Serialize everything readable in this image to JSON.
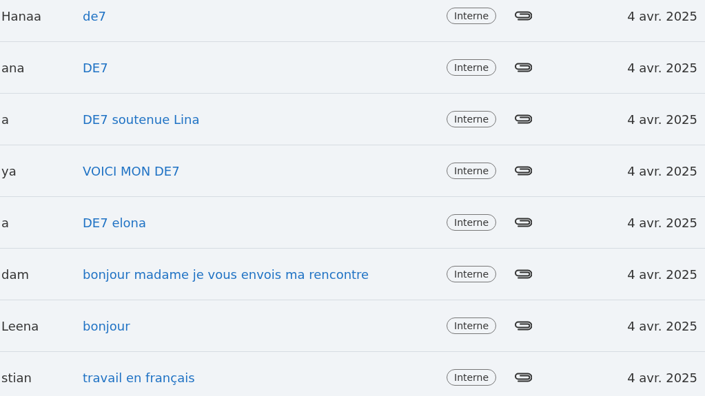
{
  "messages": [
    {
      "sender": "Hanaa",
      "subject": "de7",
      "tag": "Interne",
      "date": "4 avr. 2025"
    },
    {
      "sender": "ana",
      "subject": "DE7",
      "tag": "Interne",
      "date": "4 avr. 2025"
    },
    {
      "sender": "a",
      "subject": "DE7 soutenue Lina",
      "tag": "Interne",
      "date": "4 avr. 2025"
    },
    {
      "sender": "ya",
      "subject": "VOICI MON DE7",
      "tag": "Interne",
      "date": "4 avr. 2025"
    },
    {
      "sender": "a",
      "subject": "DE7 elona",
      "tag": "Interne",
      "date": "4 avr. 2025"
    },
    {
      "sender": "dam",
      "subject": "bonjour madame je vous envois ma rencontre",
      "tag": "Interne",
      "date": "4 avr. 2025"
    },
    {
      "sender": "Leena",
      "subject": "bonjour",
      "tag": "Interne",
      "date": "4 avr. 2025"
    },
    {
      "sender": "stian",
      "subject": "travail en français",
      "tag": "Interne",
      "date": "4 avr. 2025"
    }
  ]
}
